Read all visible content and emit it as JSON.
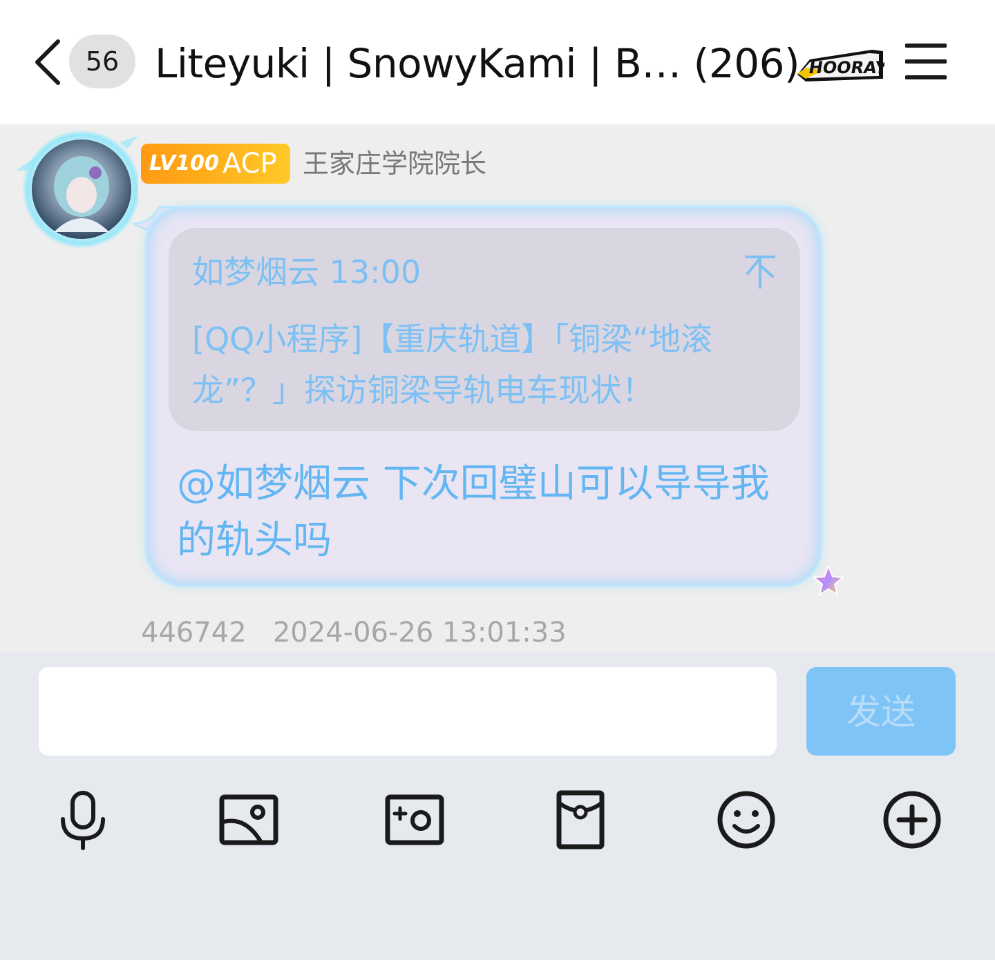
{
  "header": {
    "unread_count": "56",
    "title": "Liteyuki | SnowyKami | B… (206)",
    "badge_icon": "hooray-badge"
  },
  "message": {
    "level_label": "LV100",
    "level_title": "ACP",
    "member_title": "王家庄学院院长",
    "quote": {
      "sender_time": "如梦烟云 13:00",
      "text": "[QQ小程序]【重庆轨道】「铜梁“地滚龙”？」探访铜梁导轨电车现状！"
    },
    "text": "@如梦烟云 下次回璧山可以导导我的轨头吗",
    "meta": "446742   2024-06-26 13:01:33"
  },
  "composer": {
    "input_value": "",
    "input_placeholder": "",
    "send_label": "发送"
  },
  "toolbar": [
    "microphone-icon",
    "image-icon",
    "camera-icon",
    "red-packet-icon",
    "emoji-icon",
    "plus-icon"
  ],
  "colors": {
    "accent_text": "#64b6f2",
    "send_button": "#7ec4f6",
    "level_badge": "#ffb11c"
  }
}
